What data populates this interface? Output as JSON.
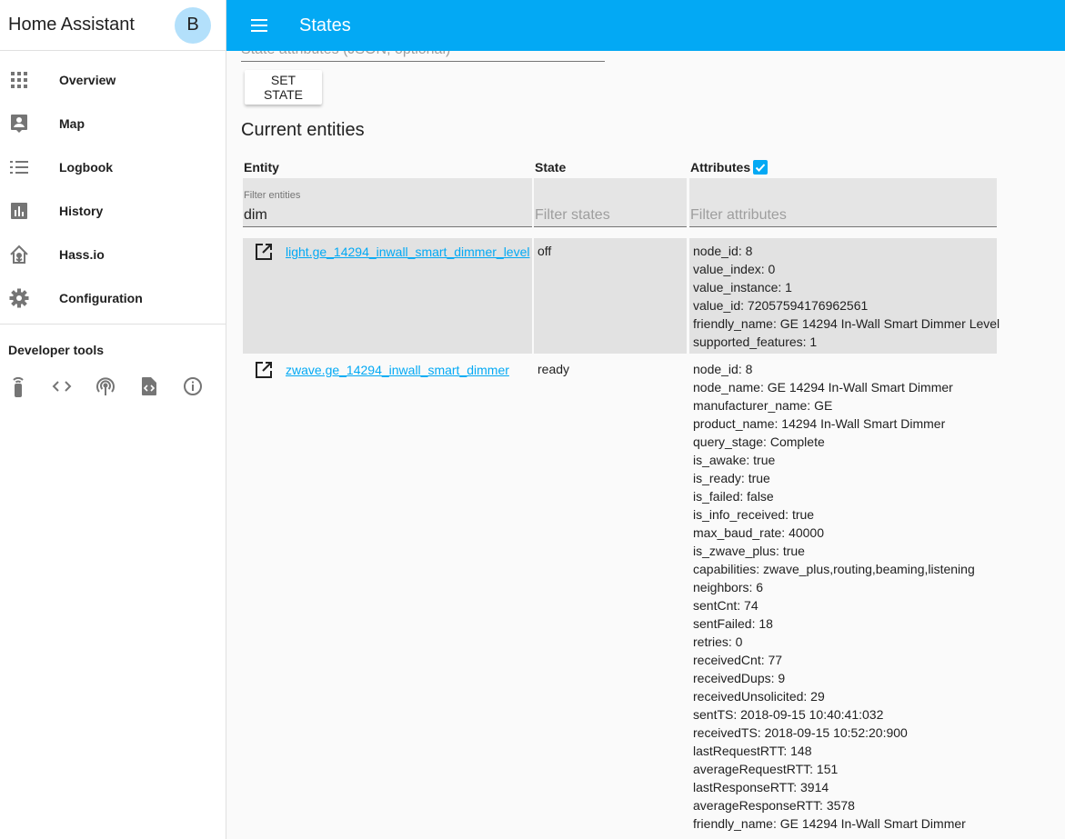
{
  "app": {
    "title": "Home Assistant",
    "user_initial": "B"
  },
  "sidebar": {
    "items": [
      {
        "label": "Overview",
        "icon": "apps-grid-icon"
      },
      {
        "label": "Map",
        "icon": "account-box-icon"
      },
      {
        "label": "Logbook",
        "icon": "list-icon"
      },
      {
        "label": "History",
        "icon": "bar-chart-icon"
      },
      {
        "label": "Hass.io",
        "icon": "hassio-icon"
      },
      {
        "label": "Configuration",
        "icon": "gear-icon"
      }
    ],
    "dev_tools_title": "Developer tools",
    "dev_tools": [
      "remote-icon",
      "code-icon",
      "antenna-icon",
      "template-file-icon",
      "info-icon"
    ]
  },
  "topbar": {
    "title": "States"
  },
  "form": {
    "attributes_placeholder": "State attributes (JSON, optional)",
    "set_state_label": "SET STATE"
  },
  "section_title": "Current entities",
  "table": {
    "headers": {
      "entity": "Entity",
      "state": "State",
      "attributes": "Attributes"
    },
    "attributes_checked": true,
    "filters": {
      "entity_label": "Filter entities",
      "entity_value": "dim",
      "state_placeholder": "Filter states",
      "attributes_placeholder": "Filter attributes"
    },
    "rows": [
      {
        "entity": "light.ge_14294_inwall_smart_dimmer_level",
        "state": "off",
        "attributes": [
          "node_id: 8",
          "value_index: 0",
          "value_instance: 1",
          "value_id: 72057594176962561",
          "friendly_name: GE 14294 In-Wall Smart Dimmer Level",
          "supported_features: 1"
        ]
      },
      {
        "entity": "zwave.ge_14294_inwall_smart_dimmer",
        "state": "ready",
        "attributes": [
          "node_id: 8",
          "node_name: GE 14294 In-Wall Smart Dimmer",
          "manufacturer_name: GE",
          "product_name: 14294 In-Wall Smart Dimmer",
          "query_stage: Complete",
          "is_awake: true",
          "is_ready: true",
          "is_failed: false",
          "is_info_received: true",
          "max_baud_rate: 40000",
          "is_zwave_plus: true",
          "capabilities: zwave_plus,routing,beaming,listening",
          "neighbors: 6",
          "sentCnt: 74",
          "sentFailed: 18",
          "retries: 0",
          "receivedCnt: 77",
          "receivedDups: 9",
          "receivedUnsolicited: 29",
          "sentTS: 2018-09-15 10:40:41:032",
          "receivedTS: 2018-09-15 10:52:20:900",
          "lastRequestRTT: 148",
          "averageRequestRTT: 151",
          "lastResponseRTT: 3914",
          "averageResponseRTT: 3578",
          "friendly_name: GE 14294 In-Wall Smart Dimmer"
        ]
      }
    ]
  }
}
